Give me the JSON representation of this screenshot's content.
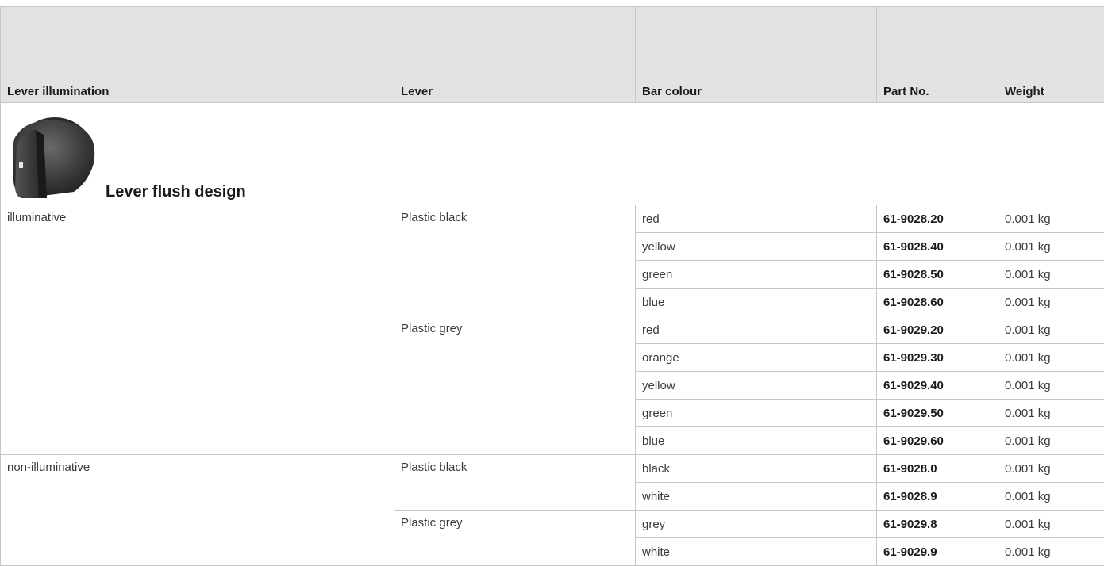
{
  "table": {
    "headers": {
      "illumination": "Lever illumination",
      "lever": "Lever",
      "bar_colour": "Bar colour",
      "part_no": "Part No.",
      "weight": "Weight"
    },
    "section": {
      "title": "Lever flush design",
      "image": "knob-icon"
    },
    "groups": [
      {
        "illumination": "illuminative",
        "levers": [
          {
            "lever": "Plastic black",
            "rows": [
              {
                "colour": "red",
                "part": "61-9028.20",
                "weight": "0.001 kg"
              },
              {
                "colour": "yellow",
                "part": "61-9028.40",
                "weight": "0.001 kg"
              },
              {
                "colour": "green",
                "part": "61-9028.50",
                "weight": "0.001 kg"
              },
              {
                "colour": "blue",
                "part": "61-9028.60",
                "weight": "0.001 kg"
              }
            ]
          },
          {
            "lever": "Plastic grey",
            "rows": [
              {
                "colour": "red",
                "part": "61-9029.20",
                "weight": "0.001 kg"
              },
              {
                "colour": "orange",
                "part": "61-9029.30",
                "weight": "0.001 kg"
              },
              {
                "colour": "yellow",
                "part": "61-9029.40",
                "weight": "0.001 kg"
              },
              {
                "colour": "green",
                "part": "61-9029.50",
                "weight": "0.001 kg"
              },
              {
                "colour": "blue",
                "part": "61-9029.60",
                "weight": "0.001 kg"
              }
            ]
          }
        ]
      },
      {
        "illumination": "non-illuminative",
        "levers": [
          {
            "lever": "Plastic black",
            "rows": [
              {
                "colour": "black",
                "part": "61-9028.0",
                "weight": "0.001 kg"
              },
              {
                "colour": "white",
                "part": "61-9028.9",
                "weight": "0.001 kg"
              }
            ]
          },
          {
            "lever": "Plastic grey",
            "rows": [
              {
                "colour": "grey",
                "part": "61-9029.8",
                "weight": "0.001 kg"
              },
              {
                "colour": "white",
                "part": "61-9029.9",
                "weight": "0.001 kg"
              }
            ]
          }
        ]
      }
    ]
  }
}
